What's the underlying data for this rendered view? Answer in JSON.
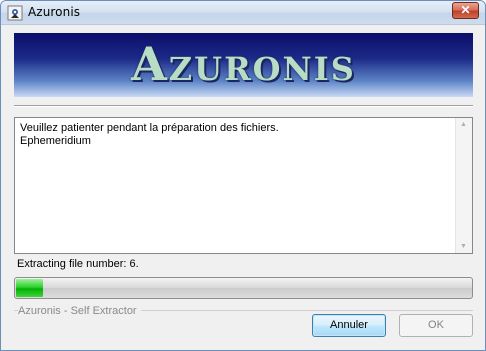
{
  "window": {
    "title": "Azuronis",
    "icon": "installer-icon",
    "close_symbol": "✕"
  },
  "banner": {
    "text": "Azuronis",
    "text_color": "#b9dcc4"
  },
  "log": {
    "lines": [
      "Veuillez patienter pendant la préparation des fichiers.",
      "Ephemeridium"
    ],
    "scroll_up_symbol": "▲",
    "scroll_down_symbol": "▼"
  },
  "status": {
    "text": "Extracting file number: 6."
  },
  "progress": {
    "fraction": 0.06,
    "fill_color": "#06b006"
  },
  "footer": {
    "label": "Azuronis - Self Extractor"
  },
  "buttons": {
    "cancel_label": "Annuler",
    "ok_label": "OK"
  }
}
